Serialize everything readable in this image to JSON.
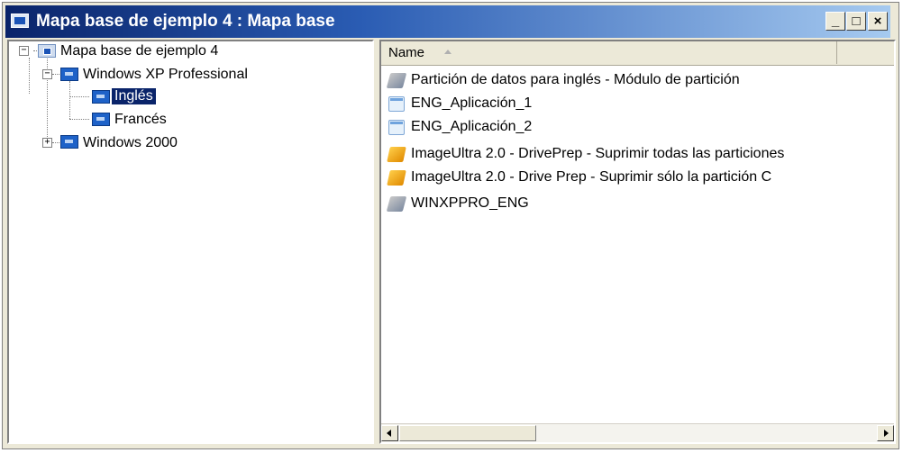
{
  "window": {
    "title": "Mapa base de ejemplo 4 : Mapa base",
    "minimize_label": "_",
    "maximize_label": "□",
    "close_label": "×"
  },
  "tree": {
    "root": {
      "label": "Mapa base de ejemplo 4",
      "icon": "base-map-icon",
      "expander": "−"
    },
    "children": [
      {
        "label": "Windows XP Professional",
        "icon": "os-node-icon",
        "expander": "−",
        "children": [
          {
            "label": "Inglés",
            "icon": "language-node-icon",
            "selected": true
          },
          {
            "label": "Francés",
            "icon": "language-node-icon",
            "selected": false
          }
        ]
      },
      {
        "label": "Windows 2000",
        "icon": "os-node-icon",
        "expander": "+"
      }
    ],
    "selection_color": "#0a246a"
  },
  "list": {
    "column_header": "Name",
    "items": [
      {
        "label": "Partición de datos para inglés  - Módulo de partición",
        "icon": "partition-module-icon"
      },
      {
        "label": "ENG_Aplicación_1",
        "icon": "application-icon"
      },
      {
        "label": "ENG_Aplicación_2",
        "icon": "application-icon"
      },
      {
        "label": "ImageUltra 2.0 - DrivePrep - Suprimir todas las particiones",
        "icon": "utility-icon"
      },
      {
        "label": "ImageUltra 2.0 - Drive Prep - Suprimir sólo la partición C",
        "icon": "utility-icon"
      },
      {
        "label": "WINXPPRO_ENG",
        "icon": "partition-module-icon"
      }
    ]
  },
  "colors": {
    "title_gradient_start": "#0a246a",
    "title_gradient_end": "#a6caf0",
    "window_bg": "#ece9d8"
  }
}
